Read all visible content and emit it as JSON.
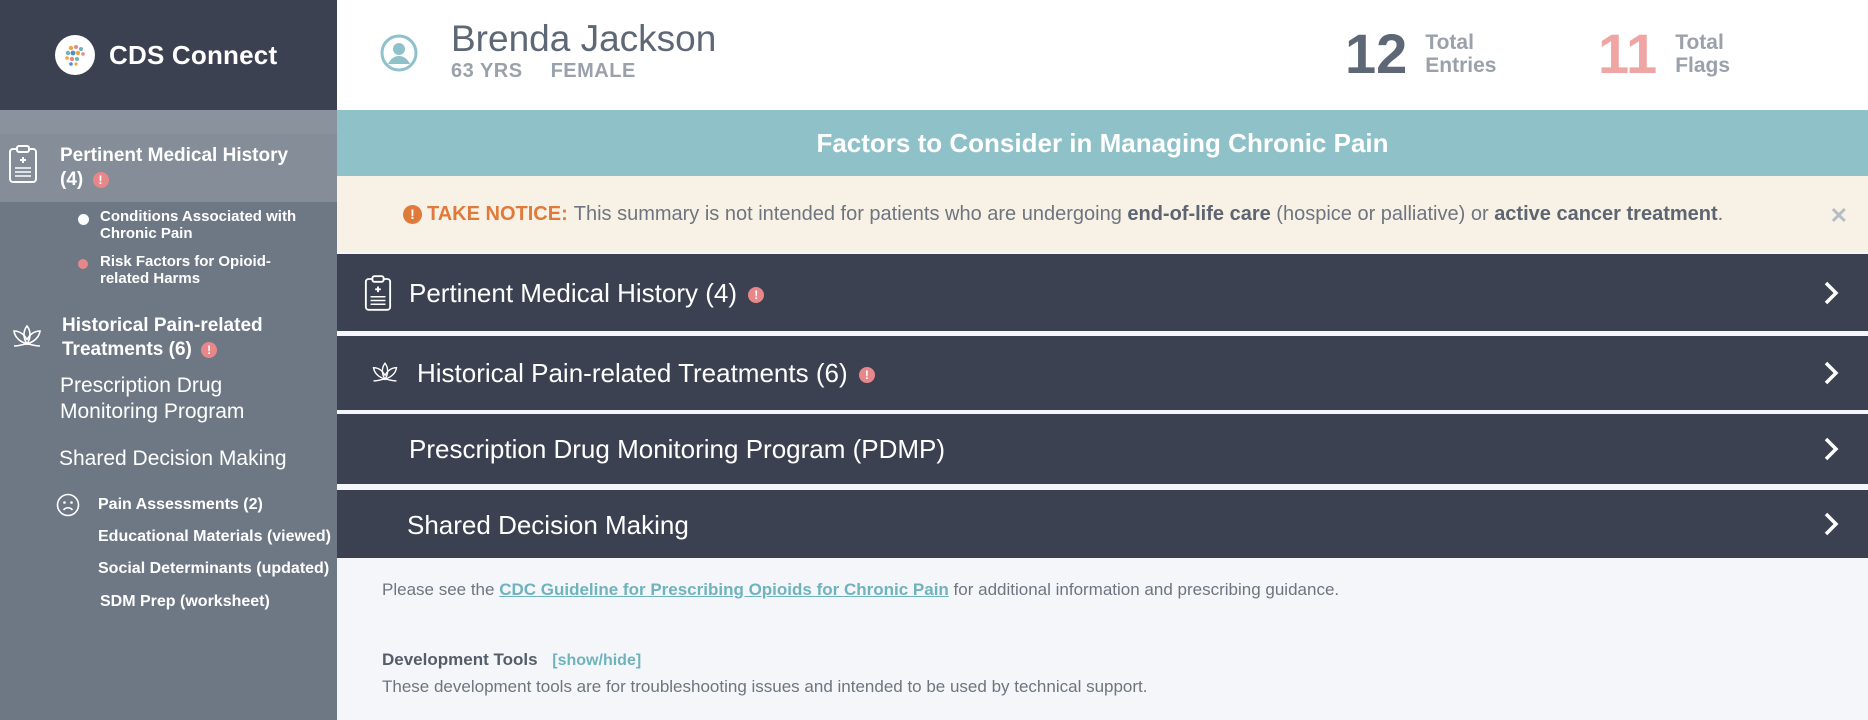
{
  "brand": {
    "name": "CDS Connect"
  },
  "sidebar": {
    "pertinent": {
      "title": "Pertinent Medical History",
      "count": "(4)",
      "flag": "!"
    },
    "pertinent_items": [
      "Conditions Associated with Chronic Pain",
      "Risk Factors for Opioid-related Harms"
    ],
    "historical": {
      "title": "Historical Pain-related Treatments (6)",
      "flag": "!"
    },
    "pdmp": "Prescription Drug Monitoring Program",
    "sdm": "Shared Decision Making",
    "sdm_items": [
      "Pain Assessments (2)",
      "Educational Materials (viewed)",
      "Social Determinants (updated)",
      "SDM Prep (worksheet)"
    ]
  },
  "patient": {
    "name": "Brenda Jackson",
    "age": "63 YRS",
    "gender": "FEMALE"
  },
  "stats": {
    "entries": {
      "value": "12",
      "label1": "Total",
      "label2": "Entries",
      "color": "#5d6775"
    },
    "flags": {
      "value": "11",
      "label1": "Total",
      "label2": "Flags",
      "color": "#f0a5a5"
    }
  },
  "banner": {
    "title": "Factors to Consider in Managing Chronic Pain"
  },
  "notice": {
    "icon": "!",
    "label": "TAKE NOTICE:",
    "text1": "This summary is not intended for patients who are undergoing",
    "bold1": "end-of-life care",
    "text2": "(hospice or palliative) or",
    "bold2": "active cancer treatment",
    "text3": ".",
    "close": "✕"
  },
  "sections": [
    {
      "title": "Pertinent Medical History (4)",
      "flag": "!",
      "icon": "clipboard-icon"
    },
    {
      "title": "Historical Pain-related Treatments (6)",
      "flag": "!",
      "icon": "lotus-icon"
    },
    {
      "title": "Prescription Drug Monitoring Program (PDMP)"
    },
    {
      "title": "Shared Decision Making"
    }
  ],
  "footer": {
    "pre": "Please see the",
    "link": "CDC Guideline for Prescribing Opioids for Chronic Pain",
    "post": "for additional information and prescribing guidance."
  },
  "devtools": {
    "title": "Development Tools",
    "toggle": "[show/hide]",
    "desc": "These development tools are for troubleshooting issues and intended to be used by technical support."
  }
}
